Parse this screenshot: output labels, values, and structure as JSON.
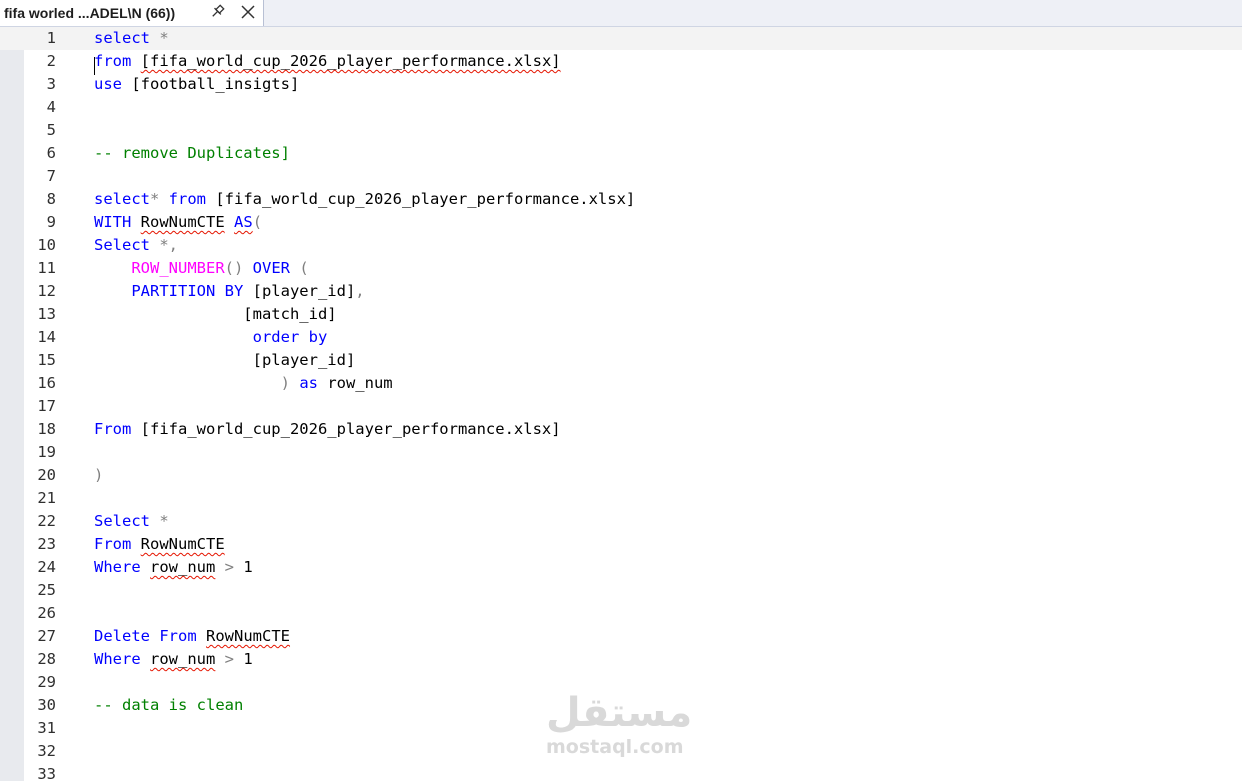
{
  "tab": {
    "title": "fifa worled ...ADEL\\N (66))",
    "pin_icon": "pin-icon",
    "close_icon": "close-icon"
  },
  "colors": {
    "keyword": "#0000ff",
    "function": "#ff00ff",
    "operator": "#808080",
    "comment": "#008000",
    "error_squiggle": "#e51400"
  },
  "editor": {
    "current_line": 1,
    "lines": [
      [
        {
          "t": "kw",
          "v": "select"
        },
        {
          "t": "op",
          "v": " *"
        }
      ],
      [
        {
          "t": "kw",
          "v": "from"
        },
        {
          "t": "id",
          "v": " "
        },
        {
          "t": "id",
          "v": "[fifa_world_cup_2026_player_performance.xlsx]",
          "e": 1
        }
      ],
      [
        {
          "t": "kw",
          "v": "use"
        },
        {
          "t": "id",
          "v": " [football_insigts]"
        }
      ],
      [],
      [],
      [
        {
          "t": "cm",
          "v": "-- remove Duplicates]"
        }
      ],
      [],
      [
        {
          "t": "kw",
          "v": "select"
        },
        {
          "t": "op",
          "v": "* "
        },
        {
          "t": "kw",
          "v": "from"
        },
        {
          "t": "id",
          "v": " [fifa_world_cup_2026_player_performance.xlsx]"
        }
      ],
      [
        {
          "t": "kw",
          "v": "WITH"
        },
        {
          "t": "id",
          "v": " "
        },
        {
          "t": "id",
          "v": "RowNumCTE",
          "e": 1
        },
        {
          "t": "id",
          "v": " "
        },
        {
          "t": "kw",
          "v": "AS",
          "e": 1
        },
        {
          "t": "op",
          "v": "("
        }
      ],
      [
        {
          "t": "kw",
          "v": "Select"
        },
        {
          "t": "op",
          "v": " *,"
        }
      ],
      [
        {
          "t": "id",
          "v": "    "
        },
        {
          "t": "fn",
          "v": "ROW_NUMBER"
        },
        {
          "t": "op",
          "v": "() "
        },
        {
          "t": "kw",
          "v": "OVER"
        },
        {
          "t": "op",
          "v": " ("
        }
      ],
      [
        {
          "t": "id",
          "v": "    "
        },
        {
          "t": "kw",
          "v": "PARTITION BY"
        },
        {
          "t": "id",
          "v": " [player_id]"
        },
        {
          "t": "op",
          "v": ","
        }
      ],
      [
        {
          "t": "id",
          "v": "                [match_id]"
        }
      ],
      [
        {
          "t": "id",
          "v": "                 "
        },
        {
          "t": "kw",
          "v": "order by"
        }
      ],
      [
        {
          "t": "id",
          "v": "                 [player_id]"
        }
      ],
      [
        {
          "t": "op",
          "v": "                    ) "
        },
        {
          "t": "kw",
          "v": "as"
        },
        {
          "t": "id",
          "v": " row_num"
        }
      ],
      [],
      [
        {
          "t": "kw",
          "v": "From"
        },
        {
          "t": "id",
          "v": " [fifa_world_cup_2026_player_performance.xlsx]"
        }
      ],
      [],
      [
        {
          "t": "op",
          "v": ")"
        }
      ],
      [],
      [
        {
          "t": "kw",
          "v": "Select"
        },
        {
          "t": "op",
          "v": " *"
        }
      ],
      [
        {
          "t": "kw",
          "v": "From"
        },
        {
          "t": "id",
          "v": " "
        },
        {
          "t": "id",
          "v": "RowNumCTE",
          "e": 1
        }
      ],
      [
        {
          "t": "kw",
          "v": "Where"
        },
        {
          "t": "id",
          "v": " "
        },
        {
          "t": "id",
          "v": "row_num",
          "e": 1
        },
        {
          "t": "op",
          "v": " > "
        },
        {
          "t": "id",
          "v": "1"
        }
      ],
      [],
      [],
      [
        {
          "t": "kw",
          "v": "Delete"
        },
        {
          "t": "id",
          "v": " "
        },
        {
          "t": "kw",
          "v": "From"
        },
        {
          "t": "id",
          "v": " "
        },
        {
          "t": "id",
          "v": "RowNumCTE",
          "e": 1
        }
      ],
      [
        {
          "t": "kw",
          "v": "Where"
        },
        {
          "t": "id",
          "v": " "
        },
        {
          "t": "id",
          "v": "row_num",
          "e": 1
        },
        {
          "t": "op",
          "v": " > "
        },
        {
          "t": "id",
          "v": "1"
        }
      ],
      [],
      [
        {
          "t": "cm",
          "v": "-- data is clean"
        }
      ],
      [],
      [],
      []
    ]
  },
  "watermark": {
    "arabic": "مستقل",
    "latin": "mostaql.com"
  }
}
